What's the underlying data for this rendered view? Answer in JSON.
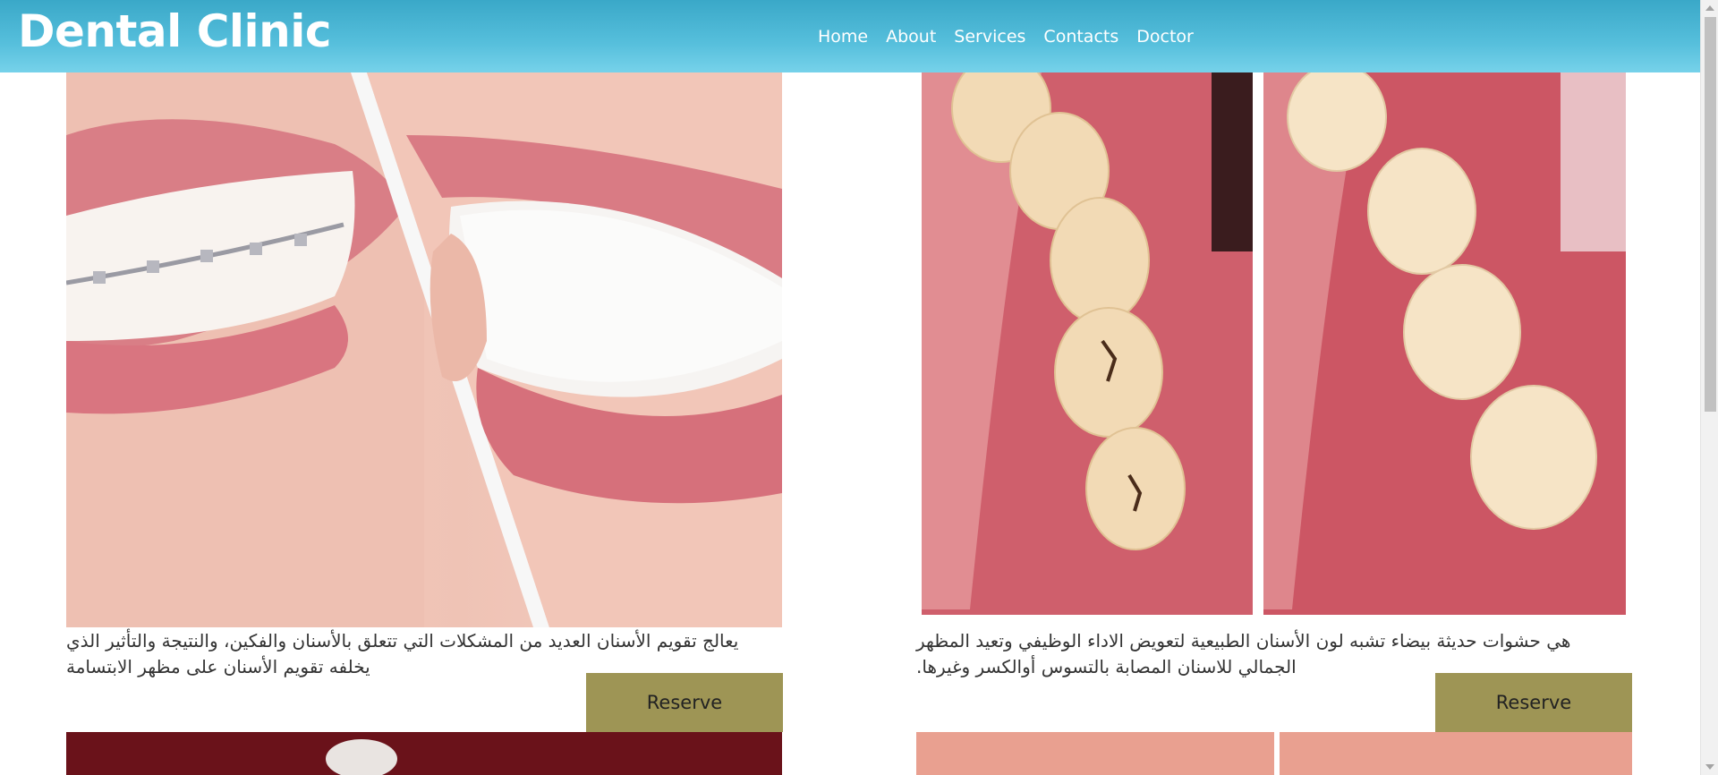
{
  "header": {
    "brand": "Dental Clinic",
    "nav": [
      "Home",
      "About",
      "Services",
      "Contacts",
      "Doctor"
    ]
  },
  "cards": [
    {
      "image": "braces-vs-clear-aligners-photo",
      "text": "يعالج تقويم الأسنان العديد من المشكلات التي تتعلق بالأسنان والفكين، والنتيجة والتأثير الذي يخلفه تقويم الأسنان على مظهر الابتسامة",
      "button": "Reserve"
    },
    {
      "image": "tooth-fillings-before-after-photo",
      "text": "هي حشوات حديثة بيضاء تشبه لون الأسنان الطبيعية لتعويض الاداء الوظيفي وتعيد المظهر الجمالي للاسنان المصابة بالتسوس أوالكسر وغيرها.",
      "button": "Reserve"
    },
    {
      "image": "dental-photo-3"
    },
    {
      "image": "dental-photo-4"
    }
  ],
  "colors": {
    "navbar": "#56bfdc",
    "button": "#9e9555",
    "text": "#333333"
  }
}
